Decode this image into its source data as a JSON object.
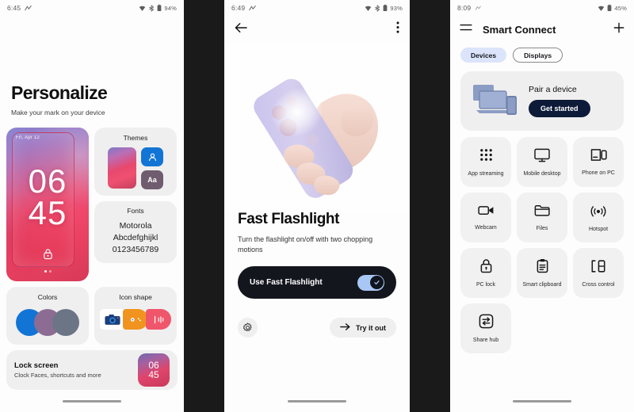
{
  "phone1": {
    "statusbar": {
      "time": "6:45",
      "battery": "94%",
      "left_icon": "network-activity-icon",
      "icons": [
        "wifi-icon",
        "bluetooth-icon",
        "battery-icon"
      ]
    },
    "title": "Personalize",
    "subtitle": "Make your mark on your device",
    "wallpaper": {
      "date": "Fri, Apr 12",
      "hour": "06",
      "minute": "45",
      "lock_icon": "lock-icon"
    },
    "themes": {
      "title": "Themes",
      "icon_a": "person-icon",
      "icon_b": "Aa"
    },
    "fonts": {
      "title": "Fonts",
      "line1": "Motorola",
      "line2": "Abcdefghijkl",
      "line3": "0123456789"
    },
    "colors": {
      "title": "Colors",
      "swatches": [
        "#1275d6",
        "#8d6c93",
        "#6b7585"
      ]
    },
    "icon_shape": {
      "title": "Icon shape",
      "apps": [
        "camera-icon",
        "games-icon",
        "audio-icon"
      ]
    },
    "lock_screen": {
      "title": "Lock screen",
      "subtitle": "Clock Faces, shortcuts and more",
      "thumb_hour": "06",
      "thumb_minute": "45"
    }
  },
  "phone2": {
    "statusbar": {
      "time": "6:49",
      "battery": "93%",
      "left_icon": "network-activity-icon"
    },
    "topbar": {
      "back": "back-arrow-icon",
      "overflow": "more-vert-icon"
    },
    "illustration": "hand-holding-phone-flashlight",
    "title": "Fast Flashlight",
    "description": "Turn the flashlight on/off with two chopping motions",
    "toggle": {
      "label": "Use Fast Flashlight",
      "state": "on",
      "track_color": "#a8c7f5",
      "knob_color": "#10141c"
    },
    "settings_button": "gear-icon",
    "try_button": {
      "label": "Try it out",
      "icon": "arrow-right-icon"
    }
  },
  "phone3": {
    "statusbar": {
      "time": "8:09",
      "battery": "45%",
      "left_icon": "network-activity-icon"
    },
    "appbar": {
      "menu": "hamburger-menu-icon",
      "title": "Smart Connect",
      "add": "plus-icon"
    },
    "chips": [
      {
        "label": "Devices",
        "selected": true
      },
      {
        "label": "Displays",
        "selected": false
      }
    ],
    "pair_card": {
      "title": "Pair a device",
      "button": "Get started",
      "art": "laptop-monitor-phone-illustration"
    },
    "grid": [
      {
        "label": "App streaming",
        "icon": "app-grid-icon"
      },
      {
        "label": "Mobile desktop",
        "icon": "monitor-icon"
      },
      {
        "label": "Phone on PC",
        "icon": "phone-on-pc-icon"
      },
      {
        "label": "Webcam",
        "icon": "video-camera-icon"
      },
      {
        "label": "Files",
        "icon": "folder-icon"
      },
      {
        "label": "Hotspot",
        "icon": "hotspot-icon"
      },
      {
        "label": "PC lock",
        "icon": "padlock-icon"
      },
      {
        "label": "Smart clipboard",
        "icon": "clipboard-icon"
      },
      {
        "label": "Cross control",
        "icon": "cross-control-icon"
      },
      {
        "label": "Share hub",
        "icon": "transfer-arrows-icon"
      }
    ]
  }
}
